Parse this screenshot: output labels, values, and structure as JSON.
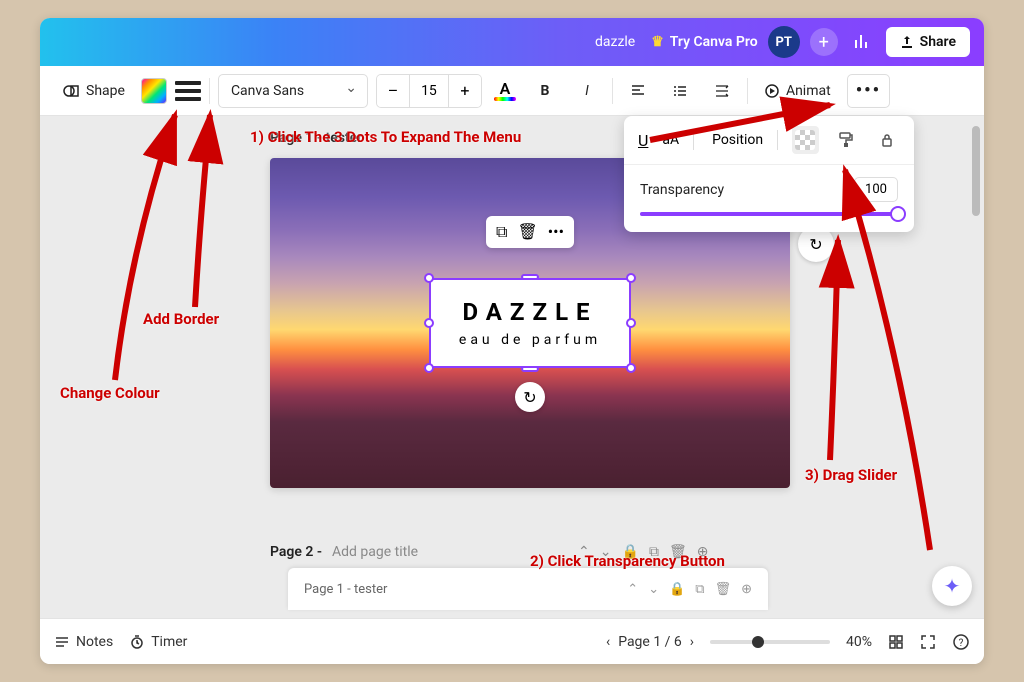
{
  "header": {
    "doc_title": "dazzle",
    "try_pro": "Try Canva Pro",
    "avatar": "PT",
    "share": "Share"
  },
  "toolbar": {
    "shape": "Shape",
    "font": "Canva Sans",
    "size": "15",
    "animate": "Animat"
  },
  "page1": {
    "label": "Page 1 - tester",
    "text_title": "DAZZLE",
    "text_sub": "eau de parfum"
  },
  "page2": {
    "label": "Page 2 -",
    "placeholder": "Add page title",
    "strip_label": "Page 1 - tester"
  },
  "expanded": {
    "position": "Position",
    "transparency_label": "Transparency",
    "transparency_value": "100"
  },
  "footer": {
    "notes": "Notes",
    "timer": "Timer",
    "page_counter": "Page 1 / 6",
    "zoom": "40%"
  },
  "annotations": {
    "change_colour": "Change Colour",
    "add_border": "Add Border",
    "step1": "1) Click The 3 Dots To Expand The Menu",
    "step2": "2) Click Transparency Button",
    "step3": "3) Drag Slider"
  }
}
